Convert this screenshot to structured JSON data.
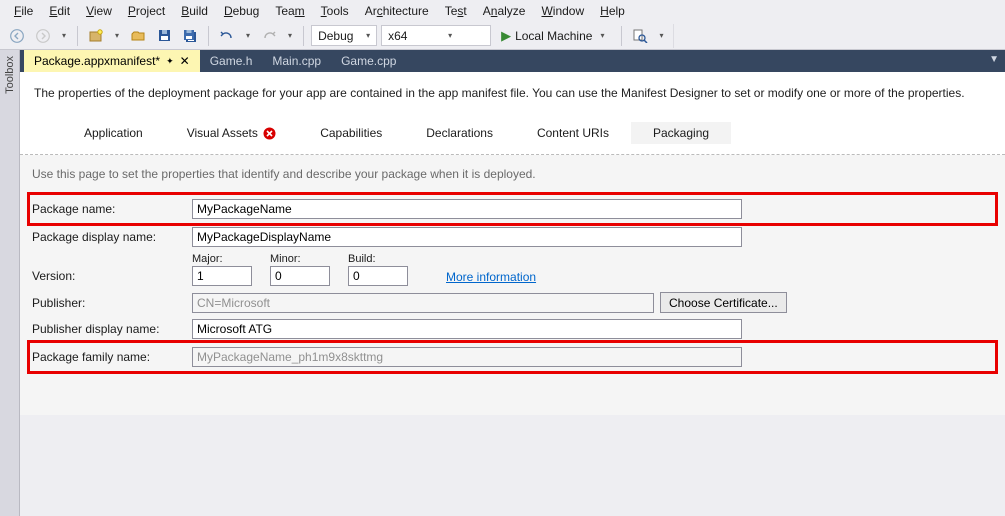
{
  "menu": [
    "File",
    "Edit",
    "View",
    "Project",
    "Build",
    "Debug",
    "Team",
    "Tools",
    "Architecture",
    "Test",
    "Analyze",
    "Window",
    "Help"
  ],
  "toolbar": {
    "config": "Debug",
    "platform": "x64",
    "run_target": "Local Machine"
  },
  "sidebar": "Toolbox",
  "tabs": [
    {
      "label": "Package.appxmanifest*",
      "active": true,
      "pinned": true
    },
    {
      "label": "Game.h"
    },
    {
      "label": "Main.cpp"
    },
    {
      "label": "Game.cpp"
    }
  ],
  "designer": {
    "intro": "The properties of the deployment package for your app are contained in the app manifest file. You can use the Manifest Designer to set or modify one or more of the properties.",
    "subtabs": [
      "Application",
      "Visual Assets",
      "Capabilities",
      "Declarations",
      "Content URIs",
      "Packaging"
    ]
  },
  "form": {
    "hint": "Use this page to set the properties that identify and describe your package when it is deployed.",
    "package_name_lbl": "Package name:",
    "package_name": "MyPackageName",
    "display_name_lbl": "Package display name:",
    "display_name": "MyPackageDisplayName",
    "version_lbl": "Version:",
    "major_lbl": "Major:",
    "major": "1",
    "minor_lbl": "Minor:",
    "minor": "0",
    "build_lbl": "Build:",
    "build": "0",
    "more_info": "More information",
    "publisher_lbl": "Publisher:",
    "publisher": "CN=Microsoft",
    "choose_cert": "Choose Certificate...",
    "pub_display_lbl": "Publisher display name:",
    "pub_display": "Microsoft ATG",
    "family_lbl": "Package family name:",
    "family": "MyPackageName_ph1m9x8skttmg"
  }
}
